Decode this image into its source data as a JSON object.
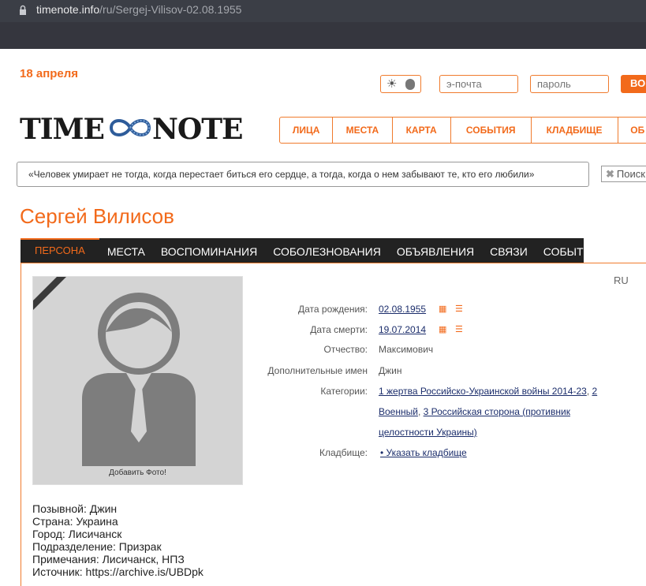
{
  "browser": {
    "url_host": "timenote.info",
    "url_path": "/ru/Sergej-Vilisov-02.08.1955"
  },
  "header": {
    "date": "18 апреля",
    "email_placeholder": "э-почта",
    "password_placeholder": "пароль",
    "login_label": "ВО"
  },
  "logo": {
    "left": "TIME",
    "right": "NOTE"
  },
  "nav": {
    "items": [
      {
        "label": "ЛИЦА"
      },
      {
        "label": "МЕСТА"
      },
      {
        "label": "КАРТА"
      },
      {
        "label": "СОБЫТИЯ"
      },
      {
        "label": "КЛАДБИЩЕ"
      },
      {
        "label": "ОБ"
      }
    ]
  },
  "quote": "«Человек умирает не тогда, когда перестает биться его сердце, а тогда, когда о нем забывают те, кто его любили»",
  "search": {
    "label": "Поиск"
  },
  "page_title": "Сергей Вилисов",
  "tabs": [
    {
      "label": "ПЕРСОНА"
    },
    {
      "label": "МЕСТА"
    },
    {
      "label": "ВОСПОМИНАНИЯ"
    },
    {
      "label": "СОБОЛЕЗНОВАНИЯ"
    },
    {
      "label": "ОБЪЯВЛЕНИЯ"
    },
    {
      "label": "СВЯЗИ"
    },
    {
      "label": "СОБЫТИЯ"
    }
  ],
  "photo": {
    "caption": "Добавить Фото!"
  },
  "lang": "RU",
  "info": {
    "birth_label": "Дата рождения:",
    "birth_value": "02.08.1955",
    "death_label": "Дата смерти:",
    "death_value": "19.07.2014",
    "patronymic_label": "Отчество:",
    "patronymic_value": "Максимович",
    "extra_names_label": "Дополнительные имен",
    "extra_names_value": "Джин",
    "categories_label": "Категории:",
    "categories_line1": "1 жертва Российско-Украинской войны 2014-23",
    "categories_line1_sep": ", ",
    "categories_line1_tail": "2",
    "categories_line2_a": "Военный",
    "categories_line2_sep": ", ",
    "categories_line2_b": "3 Российская сторона (противник",
    "categories_line3": "целостности Украины)",
    "cemetery_label": "Кладбище:",
    "cemetery_value": "• Указать кладбище"
  },
  "details": [
    "Позывной: Джин",
    "Страна: Украина",
    "Город: Лисичанск",
    "Подразделение: Призрак",
    "Примечания: Лисичанск, НПЗ",
    "Источник: https://archive.is/UBDpk"
  ],
  "colors": {
    "accent": "#f26a1b",
    "link": "#1b2d6b",
    "chrome": "#3b3e46"
  }
}
